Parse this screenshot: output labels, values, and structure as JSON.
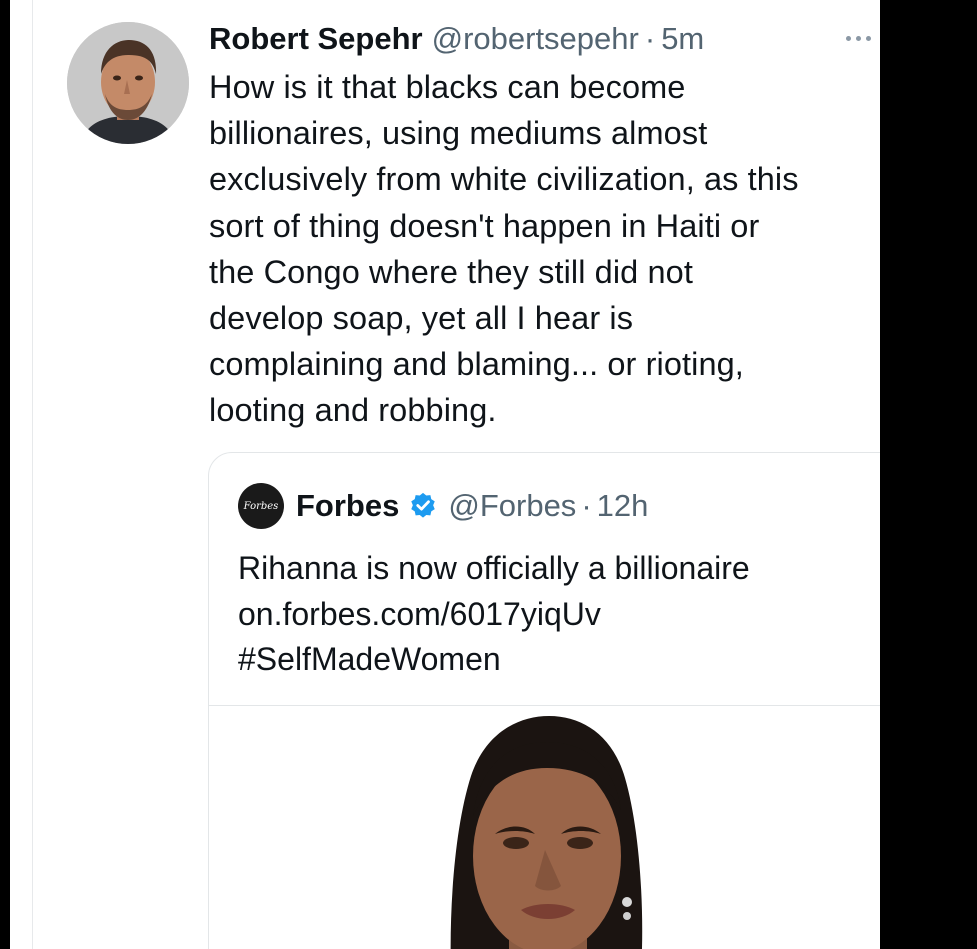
{
  "tweet": {
    "author_name": "Robert Sepehr",
    "handle": "@robertsepehr",
    "separator": "·",
    "time": "5m",
    "text_lines": [
      "How is it that blacks can become",
      "billionaires, using mediums almost",
      "exclusively from white civilization, as this",
      "sort of thing doesn't happen in Haiti or",
      "the Congo where they still did not",
      "develop soap, yet all I hear is",
      "complaining and blaming... or rioting,",
      "looting and robbing."
    ]
  },
  "quoted_tweet": {
    "logo_text": "Forbes",
    "author_name": "Forbes",
    "handle": "@Forbes",
    "separator": "·",
    "time": "12h",
    "text_lines": [
      "Rihanna is now officially a billionaire",
      "on.forbes.com/6017yiqUv",
      "#SelfMadeWomen"
    ]
  },
  "icons": {
    "more": "more-horizontal-icon",
    "verified": "verified-badge-icon"
  },
  "colors": {
    "text": "#0f1419",
    "secondary": "#536471",
    "verified_blue": "#1d9bf0",
    "border": "#e3e6e8"
  }
}
